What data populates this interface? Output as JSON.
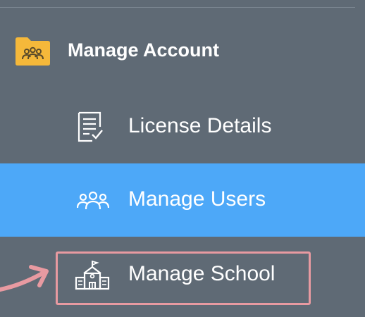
{
  "section": {
    "title": "Manage Account",
    "icon": "team-folder-icon",
    "icon_color": "#f5b83a"
  },
  "nav_items": [
    {
      "label": "License Details",
      "icon": "document-check-icon",
      "active": false
    },
    {
      "label": "Manage Users",
      "icon": "users-icon",
      "active": true
    },
    {
      "label": "Manage School",
      "icon": "school-building-icon",
      "active": false,
      "highlighted": true
    }
  ],
  "colors": {
    "sidebar_bg": "#5f6a75",
    "active_bg": "#4da8f8",
    "highlight": "#e89aa1",
    "text": "#ffffff"
  }
}
